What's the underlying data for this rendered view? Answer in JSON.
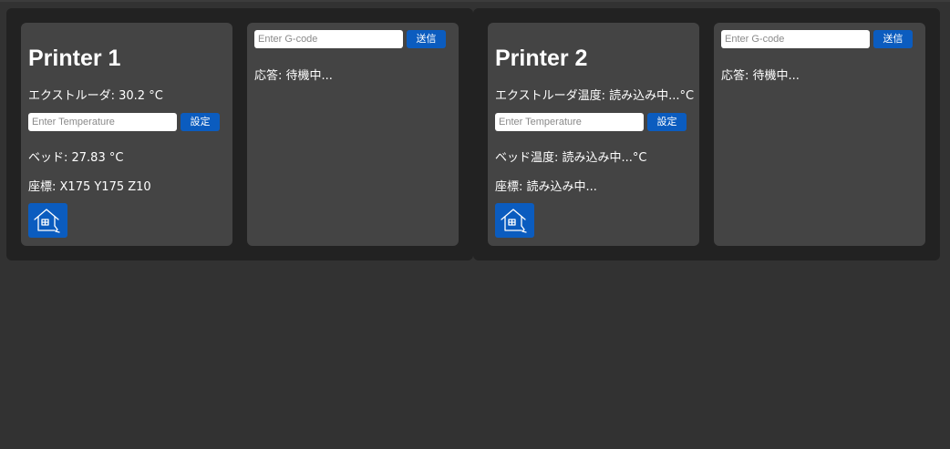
{
  "printers": [
    {
      "title": "Printer 1",
      "extruder_text": "エクストルーダ: 30.2 °C",
      "temperature_input_placeholder": "Enter Temperature",
      "set_label": "設定",
      "bed_text": "ベッド: 27.83 °C",
      "coords_text": "座標: X175 Y175 Z10",
      "home_icon": "home-icon",
      "gcode_input_placeholder": "Enter G-code",
      "send_label": "送信",
      "response_text": "応答: 待機中..."
    },
    {
      "title": "Printer 2",
      "extruder_text": "エクストルーダ温度: 読み込み中...°C",
      "temperature_input_placeholder": "Enter Temperature",
      "set_label": "設定",
      "bed_text": "ベッド温度: 読み込み中...°C",
      "coords_text": "座標: 読み込み中...",
      "home_icon": "home-icon",
      "gcode_input_placeholder": "Enter G-code",
      "send_label": "送信",
      "response_text": "応答: 待機中..."
    }
  ],
  "colors": {
    "background": "#323232",
    "panel": "#222222",
    "card": "#444444",
    "accent": "#0b5cbf",
    "text": "#ffffff"
  }
}
